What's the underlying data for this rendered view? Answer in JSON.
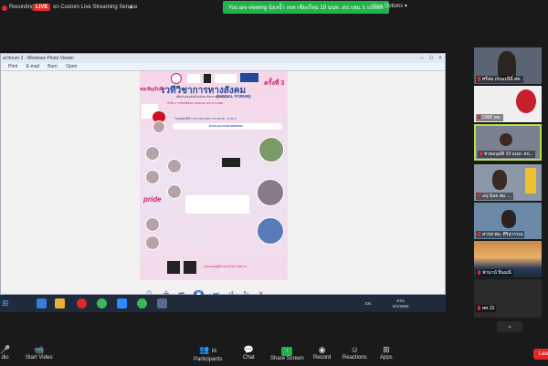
{
  "topbar": {
    "recording": "Recording",
    "live": "LIVE",
    "stream_service": "on Custom Live Streaming Service",
    "banner": "You are viewing น้องน้ำ เขต เชียงใหม่ 19 นนท. สป.รสม.'s screen",
    "view_options": "View Options"
  },
  "viewer": {
    "title": "al forum 3 - Windows Photo Viewer",
    "menu": [
      "Print",
      "E-mail",
      "Burn",
      "Open"
    ]
  },
  "poster": {
    "invite": "ขอเชิญรับฟัง",
    "headline": "เวทีวิชาการทางสังคม",
    "edition": "ครั้งที่ 3",
    "subtitle_en": "(SOCIAL FORUM)",
    "subtitle_th": "เพื่อนำเสนอข้อเท็จจริงทางวิชาการด้านสังคม",
    "topic": "หัวข้อ การขับเคลื่อนความเสมอภาคระหว่างเพศ",
    "date": "วันพฤหัสบดีที่ 6 มกราคม 2565 เวลา 09.45 - 17.00 น.",
    "platform": "ผ่านระบบ ZOOM MEETING",
    "pride": "pride",
    "organizer": "ขอขอบคุณผู้มีส่วนร่วมในการจัดงาน"
  },
  "taskbar": {
    "lang": "EN",
    "time": "9:51",
    "date": "6/1/2565"
  },
  "participants": [
    {
      "name": "ศรีสม เปรมปรีดิ์ สค."
    },
    {
      "name": "DWF สค."
    },
    {
      "name": "ช่วยอนุมัติ 19 นนท. สป..."
    },
    {
      "name": "อนุ นิลย พม. ..."
    },
    {
      "name": "สารพ พม. ศิริสุวรรณ"
    },
    {
      "name": "ฟามาน์ ปิ่นมณี"
    },
    {
      "name": "ศศ.10"
    }
  ],
  "toolbar": {
    "audio": "dio",
    "video": "Start Video",
    "participants": "Participants",
    "participants_count": "65",
    "chat": "Chat",
    "share": "Share Screen",
    "record": "Record",
    "reactions": "Reactions",
    "apps": "Apps",
    "leave": "Lea"
  },
  "colors": {
    "accent_green": "#22b24c",
    "live_red": "#e02828",
    "poster_pink": "#c81f6d",
    "poster_blue": "#1f4b9c"
  }
}
